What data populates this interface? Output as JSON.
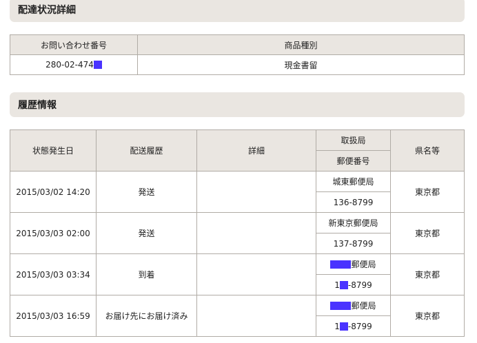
{
  "delivery": {
    "header": "配達状況詳細",
    "columns": [
      "お問い合わせ番号",
      "商品種別"
    ],
    "tracking_number_visible": "280-02-474",
    "product_type": "現金書留"
  },
  "history": {
    "header": "履歴情報",
    "columns": {
      "date": "状態発生日",
      "status": "配送履歴",
      "detail": "詳細",
      "office": "取扱局",
      "postal_code": "郵便番号",
      "prefecture": "県名等"
    },
    "rows": [
      {
        "date": "2015/03/02 14:20",
        "status": "発送",
        "detail": "",
        "office": "城東郵便局",
        "postal_code": "136-8799",
        "prefecture": "東京都"
      },
      {
        "date": "2015/03/03 02:00",
        "status": "発送",
        "detail": "",
        "office": "新東京郵便局",
        "postal_code": "137-8799",
        "prefecture": "東京都"
      },
      {
        "date": "2015/03/03 03:34",
        "status": "到着",
        "detail": "",
        "office": "郵便局",
        "postal_code_prefix": "1",
        "postal_code_suffix": "-8799",
        "prefecture": "東京都"
      },
      {
        "date": "2015/03/03 16:59",
        "status": "お届け先にお届け済み",
        "detail": "",
        "office": "郵便局",
        "postal_code_prefix": "1",
        "postal_code_suffix": "-8799",
        "prefecture": "東京都"
      }
    ]
  }
}
